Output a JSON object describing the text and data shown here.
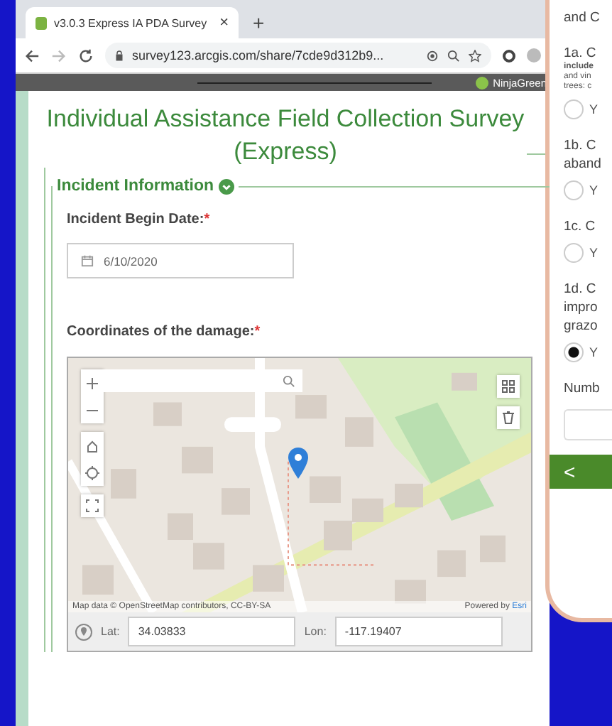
{
  "browser": {
    "tab": {
      "title": "v3.0.3 Express IA PDA Survey",
      "close": "×"
    },
    "new_tab": "+",
    "address": "survey123.arcgis.com/share/7cde9d312b9...",
    "profile": "NinjaGreen"
  },
  "form": {
    "title": "Individual Assistance Field Collection Survey (Express)",
    "section": {
      "title": "Incident Information",
      "expanded": true
    },
    "date_field": {
      "label": "Incident Begin Date:",
      "required_mark": "*",
      "value": "6/10/2020"
    },
    "location": {
      "label": "Coordinates of the damage:",
      "required_mark": "*",
      "attribution": "Map data © OpenStreetMap contributors, CC-BY-SA",
      "powered_by": "Powered by",
      "esri": "Esri",
      "lat_label": "Lat:",
      "lat": "34.03833",
      "lon_label": "Lon:",
      "lon": "-117.19407"
    }
  },
  "phone": {
    "items": [
      {
        "kind": "text",
        "text": "and C"
      },
      {
        "kind": "question",
        "text": "1a. C"
      },
      {
        "kind": "note",
        "text": "**include**"
      },
      {
        "kind": "note",
        "text": "and vin"
      },
      {
        "kind": "note",
        "text": "trees: c"
      },
      {
        "kind": "radio",
        "label": "Y",
        "selected": false
      },
      {
        "kind": "question",
        "text": "1b. C"
      },
      {
        "kind": "text",
        "text": "aband"
      },
      {
        "kind": "radio",
        "label": "Y",
        "selected": false
      },
      {
        "kind": "question",
        "text": "1c. C"
      },
      {
        "kind": "radio",
        "label": "Y",
        "selected": false
      },
      {
        "kind": "question",
        "text": "1d. C"
      },
      {
        "kind": "text",
        "text": "impro"
      },
      {
        "kind": "text",
        "text": "grazo"
      },
      {
        "kind": "radio",
        "label": "Y",
        "selected": true
      },
      {
        "kind": "question",
        "text": "Numb"
      },
      {
        "kind": "input"
      },
      {
        "kind": "nav",
        "label": "<"
      }
    ]
  }
}
